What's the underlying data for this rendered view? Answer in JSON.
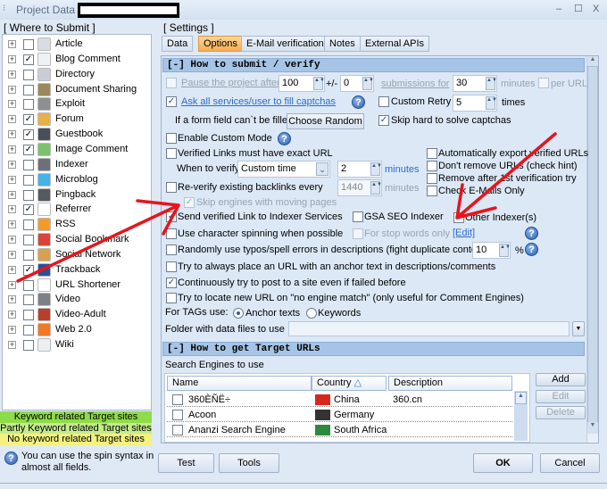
{
  "window": {
    "title": "Project Data -",
    "controls": {
      "minimize": "–",
      "maximize": "☐",
      "close": "X"
    }
  },
  "left": {
    "group_label": "[ Where to Submit ]",
    "items": [
      {
        "label": "Article",
        "checked": false,
        "icon": "article-icon",
        "color": "#d9dde3"
      },
      {
        "label": "Blog Comment",
        "checked": true,
        "icon": "speech-bubble-icon",
        "color": "#eef1f5"
      },
      {
        "label": "Directory",
        "checked": false,
        "icon": "directory-icon",
        "color": "#c9ced6"
      },
      {
        "label": "Document Sharing",
        "checked": false,
        "icon": "folder-icon",
        "color": "#9a8a5a"
      },
      {
        "label": "Exploit",
        "checked": false,
        "icon": "bug-icon",
        "color": "#8d8f91"
      },
      {
        "label": "Forum",
        "checked": true,
        "icon": "users-icon",
        "color": "#e9b04a"
      },
      {
        "label": "Guestbook",
        "checked": true,
        "icon": "book-icon",
        "color": "#4a4f57"
      },
      {
        "label": "Image Comment",
        "checked": true,
        "icon": "image-icon",
        "color": "#7cc26d"
      },
      {
        "label": "Indexer",
        "checked": false,
        "icon": "indexer-icon",
        "color": "#6d7177"
      },
      {
        "label": "Microblog",
        "checked": false,
        "icon": "bird-icon",
        "color": "#45b2e8"
      },
      {
        "label": "Pingback",
        "checked": false,
        "icon": "pingback-icon",
        "color": "#555a60"
      },
      {
        "label": "Referrer",
        "checked": true,
        "icon": "referrer-icon",
        "color": "#ffffff"
      },
      {
        "label": "RSS",
        "checked": false,
        "icon": "rss-icon",
        "color": "#f39a2b"
      },
      {
        "label": "Social Bookmark",
        "checked": false,
        "icon": "heart-icon",
        "color": "#d8443a"
      },
      {
        "label": "Social Network",
        "checked": false,
        "icon": "people-icon",
        "color": "#d8a24a"
      },
      {
        "label": "Trackback",
        "checked": true,
        "icon": "trackback-icon",
        "color": "#2a4f9a"
      },
      {
        "label": "URL Shortener",
        "checked": false,
        "icon": "chevrons-icon",
        "color": "#ffffff"
      },
      {
        "label": "Video",
        "checked": false,
        "icon": "video-icon",
        "color": "#7d8084"
      },
      {
        "label": "Video-Adult",
        "checked": false,
        "icon": "video-adult-icon",
        "color": "#b8402a"
      },
      {
        "label": "Web 2.0",
        "checked": false,
        "icon": "blogger-icon",
        "color": "#f07a22"
      },
      {
        "label": "Wiki",
        "checked": false,
        "icon": "wiki-icon",
        "color": "#eeeeee"
      }
    ],
    "legend": [
      {
        "label": "Keyword related Target sites",
        "color": "#8fdc4a"
      },
      {
        "label": "Partly Keyword related Target sites",
        "color": "#c3ec8c"
      },
      {
        "label": "No keyword related Target sites",
        "color": "#f4f27e"
      }
    ],
    "hint": [
      "You can use the spin syntax in",
      "almost all fields."
    ]
  },
  "settings": {
    "group_label": "[ Settings ]",
    "tabs": [
      {
        "label": "Data"
      },
      {
        "label": "Options",
        "active": true
      },
      {
        "label": "E-Mail verification"
      },
      {
        "label": "Notes"
      },
      {
        "label": "External APIs"
      }
    ],
    "section1": "[-] How to submit / verify",
    "pause": {
      "label": "Pause the project after",
      "value": "100",
      "pm": "+/-",
      "pm_value": "0",
      "subs": "submissions for",
      "minutes_value": "30",
      "minutes": "minutes",
      "per_url": "per URL"
    },
    "ask": "Ask all services/user to fill captchas",
    "custom_retry": {
      "label": "Custom Retry",
      "value": "5",
      "unit": "times"
    },
    "form_field": {
      "label": "If a form field can`t be filled",
      "button": "Choose Random"
    },
    "skip_hard": "Skip hard to solve captchas",
    "custom_mode": "Enable Custom Mode",
    "exact_url": "Verified Links must have exact URL",
    "when_verify": {
      "label": "When to verify",
      "value": "Custom time",
      "num": "2",
      "unit": "minutes"
    },
    "auto_export": "Automatically export verified URLs",
    "dont_remove": "Don't remove URLs (check hint)",
    "remove_after": "Remove after 1st verification try",
    "check_emails": "Check E-Mails Only",
    "reverify": {
      "label": "Re-verify existing backlinks every",
      "value": "1440",
      "unit": "minutes"
    },
    "skip_moving": "Skip engines with moving pages",
    "send_verified": "Send verified Link to Indexer Services",
    "gsa_indexer": "GSA SEO Indexer",
    "other_indexer": "Other Indexer(s)",
    "char_spin": "Use character spinning when possible",
    "stop_words": "For stop words only",
    "edit": "[Edit]",
    "typos": {
      "label": "Randomly use typos/spell errors in descriptions (fight duplicate content)",
      "value": "10",
      "unit": "%"
    },
    "anchor_url": "Try to always place an URL with an anchor text in descriptions/comments",
    "continuously": "Continuously try to post to a site even if failed before",
    "locate_url": "Try to locate new URL on \"no engine match\" (only useful for Comment Engines)",
    "tags": {
      "label": "For TAGs use:",
      "opt1": "Anchor texts",
      "opt2": "Keywords",
      "selected": "Anchor texts"
    },
    "folder": {
      "label": "Folder with  data files to use",
      "value": ""
    },
    "section2": "[-] How to get Target URLs",
    "se_label": "Search Engines to use",
    "table": {
      "headers": [
        "Name",
        "Country",
        "Description"
      ],
      "sort_indicator": "△",
      "rows": [
        {
          "name": "360ÈÑË÷",
          "country": "China",
          "desc": "360.cn",
          "flag": "#d8261c"
        },
        {
          "name": "Acoon",
          "country": "Germany",
          "desc": "",
          "flag": "#333333"
        },
        {
          "name": "Ananzi Search Engine",
          "country": "South Africa",
          "desc": "",
          "flag": "#2c8a3c"
        }
      ]
    },
    "table_buttons": {
      "add": "Add",
      "edit": "Edit",
      "delete": "Delete"
    }
  },
  "footer": {
    "test": "Test",
    "tools": "Tools",
    "ok": "OK",
    "cancel": "Cancel"
  },
  "annotation_color": "#e8141c"
}
